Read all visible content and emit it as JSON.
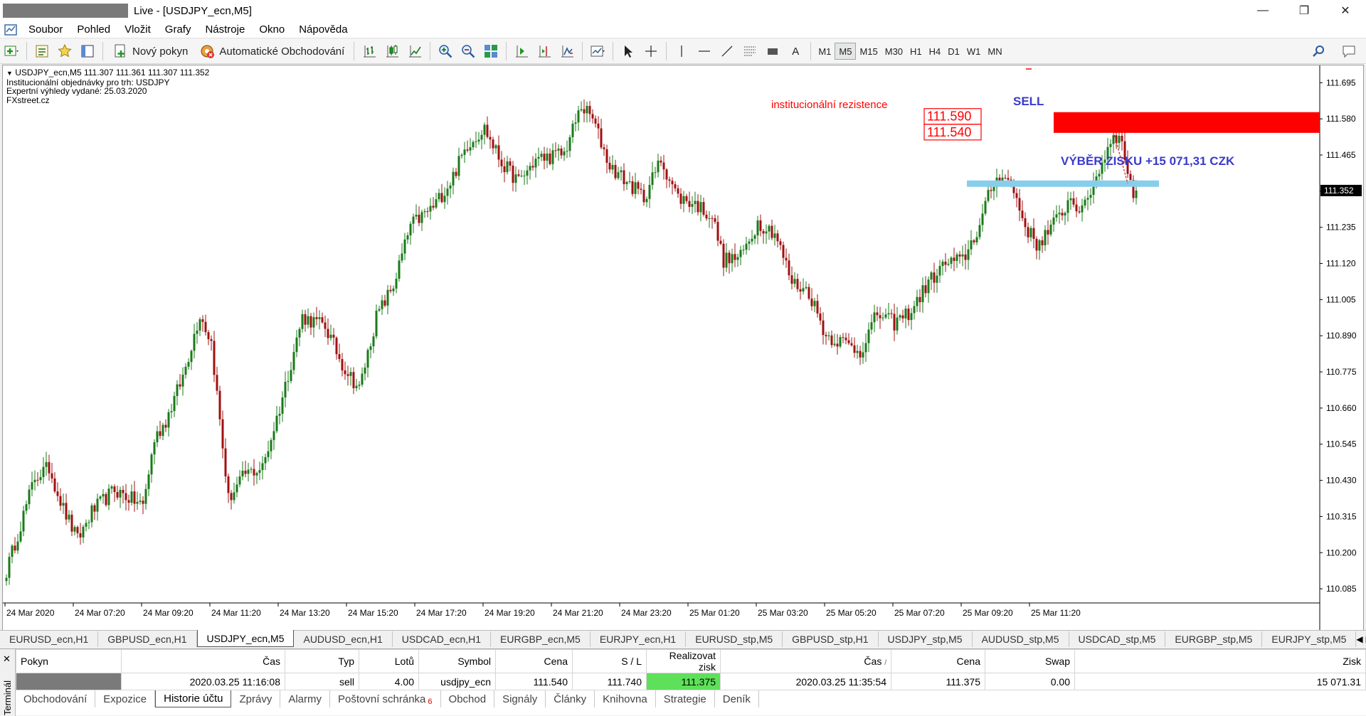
{
  "window": {
    "title": "Live - [USDJPY_ecn,M5]",
    "controls": [
      "—",
      "❐",
      "✕"
    ]
  },
  "menu": [
    "Soubor",
    "Pohled",
    "Vložit",
    "Grafy",
    "Nástroje",
    "Okno",
    "Nápověda"
  ],
  "toolbar": {
    "new_order": "Nový pokyn",
    "auto_trading": "Automatické Obchodování",
    "text_tool": "A",
    "timeframes": [
      "M1",
      "M5",
      "M15",
      "M30",
      "H1",
      "H4",
      "D1",
      "W1",
      "MN"
    ],
    "active_timeframe": "M5"
  },
  "chart": {
    "info_lines": [
      "USDJPY_ecn,M5  111.307 111.361 111.307 111.352",
      "Institucionální objednávky pro trh: USDJPY",
      "Expertní výhledy vydané: 25.03.2020",
      "FXstreet.cz"
    ],
    "annotations": {
      "resistance_label": "institucionální rezistence",
      "sell_label": "SELL",
      "price_top": "111.590",
      "price_bottom": "111.540",
      "profit_label": "VÝBĚR ZISKU +15 071,31 CZK"
    },
    "current_price": "111.352",
    "colors": {
      "bull": "#1a7a1a",
      "bear": "#a01010",
      "resistance": "#ff0000",
      "target": "#87ceeb",
      "label_blue": "#3a3acc"
    }
  },
  "chart_data": {
    "type": "candlestick",
    "symbol": "USDJPY_ecn",
    "timeframe": "M5",
    "y_ticks": [
      "111.695",
      "111.580",
      "111.465",
      "111.350",
      "111.235",
      "111.120",
      "111.005",
      "110.890",
      "110.775",
      "110.660",
      "110.545",
      "110.430",
      "110.315",
      "110.200",
      "110.085"
    ],
    "y_range": [
      110.04,
      111.75
    ],
    "x_ticks": [
      "24 Mar 2020",
      "24 Mar 07:20",
      "24 Mar 09:20",
      "24 Mar 11:20",
      "24 Mar 13:20",
      "24 Mar 15:20",
      "24 Mar 17:20",
      "24 Mar 19:20",
      "24 Mar 21:20",
      "24 Mar 23:20",
      "25 Mar 01:20",
      "25 Mar 03:20",
      "25 Mar 05:20",
      "25 Mar 07:20",
      "25 Mar 09:20",
      "25 Mar 11:20"
    ],
    "bars_per_tick": 24,
    "anchors": [
      [
        0,
        110.14
      ],
      [
        10,
        110.44
      ],
      [
        15,
        110.47
      ],
      [
        20,
        110.34
      ],
      [
        25,
        110.24
      ],
      [
        30,
        110.33
      ],
      [
        38,
        110.4
      ],
      [
        48,
        110.35
      ],
      [
        52,
        110.56
      ],
      [
        56,
        110.62
      ],
      [
        62,
        110.76
      ],
      [
        68,
        110.96
      ],
      [
        72,
        110.87
      ],
      [
        78,
        110.37
      ],
      [
        84,
        110.45
      ],
      [
        90,
        110.47
      ],
      [
        96,
        110.66
      ],
      [
        104,
        110.95
      ],
      [
        112,
        110.92
      ],
      [
        118,
        110.8
      ],
      [
        124,
        110.72
      ],
      [
        130,
        110.95
      ],
      [
        136,
        111.05
      ],
      [
        142,
        111.24
      ],
      [
        150,
        111.3
      ],
      [
        156,
        111.38
      ],
      [
        162,
        111.5
      ],
      [
        168,
        111.55
      ],
      [
        174,
        111.44
      ],
      [
        180,
        111.38
      ],
      [
        186,
        111.45
      ],
      [
        196,
        111.47
      ],
      [
        202,
        111.62
      ],
      [
        206,
        111.58
      ],
      [
        212,
        111.43
      ],
      [
        218,
        111.38
      ],
      [
        224,
        111.33
      ],
      [
        230,
        111.45
      ],
      [
        236,
        111.33
      ],
      [
        242,
        111.31
      ],
      [
        248,
        111.27
      ],
      [
        252,
        111.13
      ],
      [
        258,
        111.14
      ],
      [
        264,
        111.25
      ],
      [
        270,
        111.22
      ],
      [
        276,
        111.06
      ],
      [
        282,
        111.03
      ],
      [
        288,
        110.89
      ],
      [
        294,
        110.87
      ],
      [
        300,
        110.84
      ],
      [
        306,
        110.96
      ],
      [
        312,
        110.93
      ],
      [
        318,
        110.97
      ],
      [
        324,
        111.06
      ],
      [
        330,
        111.12
      ],
      [
        336,
        111.13
      ],
      [
        342,
        111.24
      ],
      [
        346,
        111.36
      ],
      [
        350,
        111.41
      ],
      [
        354,
        111.35
      ],
      [
        358,
        111.24
      ],
      [
        362,
        111.18
      ],
      [
        366,
        111.22
      ],
      [
        370,
        111.27
      ],
      [
        374,
        111.33
      ],
      [
        378,
        111.28
      ],
      [
        382,
        111.38
      ],
      [
        386,
        111.46
      ],
      [
        389,
        111.54
      ],
      [
        392,
        111.5
      ],
      [
        394,
        111.42
      ],
      [
        397,
        111.3
      ]
    ],
    "resistance_zone": [
      111.54,
      111.59
    ],
    "take_profit_level": 111.375,
    "last_price": 111.352
  },
  "chart_tabs": [
    "EURUSD_ecn,H1",
    "GBPUSD_ecn,H1",
    "USDJPY_ecn,M5",
    "AUDUSD_ecn,H1",
    "USDCAD_ecn,H1",
    "EURGBP_ecn,M5",
    "EURJPY_ecn,H1",
    "EURUSD_stp,M5",
    "GBPUSD_stp,H1",
    "USDJPY_stp,M5",
    "AUDUSD_stp,M5",
    "USDCAD_stp,M5",
    "EURGBP_stp,M5",
    "EURJPY_stp,M5"
  ],
  "chart_tabs_active": 2,
  "terminal": {
    "label": "Terminál",
    "headers": [
      "Pokyn",
      "Čas",
      "Typ",
      "Lotů",
      "Symbol",
      "Cena",
      "S / L",
      "Realizovat zisk",
      "Čas",
      "Cena",
      "Swap",
      "Zisk"
    ],
    "row": {
      "open_time": "2020.03.25 11:16:08",
      "type": "sell",
      "lots": "4.00",
      "symbol": "usdjpy_ecn",
      "price": "111.540",
      "sl": "111.740",
      "tp": "111.375",
      "close_time": "2020.03.25 11:35:54",
      "close_price": "111.375",
      "swap": "0.00",
      "profit": "15 071.31"
    },
    "tabs": [
      "Obchodování",
      "Expozice",
      "Historie účtu",
      "Zprávy",
      "Alarmy",
      "Poštovní schránka",
      "Obchod",
      "Signály",
      "Články",
      "Knihovna",
      "Strategie",
      "Deník"
    ],
    "active_tab": 2,
    "mailbox_badge": "6"
  }
}
